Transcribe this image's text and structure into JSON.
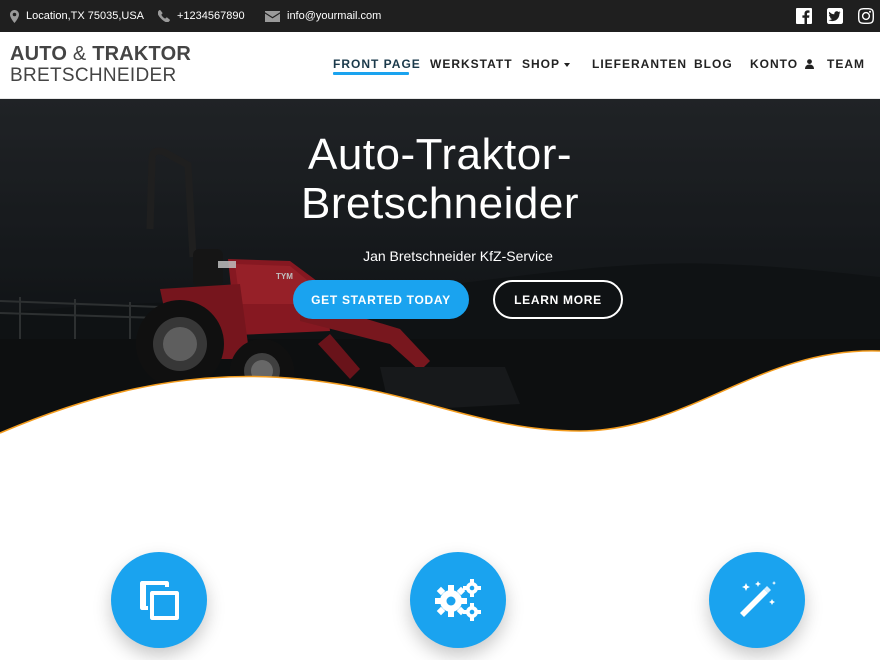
{
  "topbar": {
    "location": "Location,TX 75035,USA",
    "phone": "+1234567890",
    "email": "info@yourmail.com",
    "icons": [
      "map-marker-icon",
      "phone-icon",
      "envelope-icon",
      "facebook-icon",
      "twitter-icon",
      "instagram-icon"
    ]
  },
  "logo": {
    "line1_bold_a": "AUTO",
    "line1_amp": "&",
    "line1_bold_b": "TRAKTOR",
    "line2": "BRETSCHNEIDER"
  },
  "nav": {
    "items": [
      {
        "label": "FRONT PAGE",
        "active": true
      },
      {
        "label": "WERKSTATT"
      },
      {
        "label": "SHOP",
        "has_dropdown": true
      },
      {
        "label": "LIEFERANTEN"
      },
      {
        "label": "BLOG"
      },
      {
        "label": "KONTO",
        "icon": "user-icon"
      },
      {
        "label": "TEAM"
      }
    ]
  },
  "hero": {
    "title_line1": "Auto-Traktor-",
    "title_line2": "Bretschneider",
    "subtitle": "Jan Bretschneider KfZ-Service",
    "primary_button": "GET STARTED TODAY",
    "secondary_button": "LEARN MORE",
    "tractor_badge_text": "TYM"
  },
  "features": {
    "icons": [
      "copy-icon",
      "gears-icon",
      "magic-wand-icon"
    ]
  },
  "colors": {
    "accent": "#1aa3ef",
    "topbar_bg": "#1f1f1f",
    "wave_line": "#f39c1e",
    "tractor_red": "#b3212c"
  }
}
